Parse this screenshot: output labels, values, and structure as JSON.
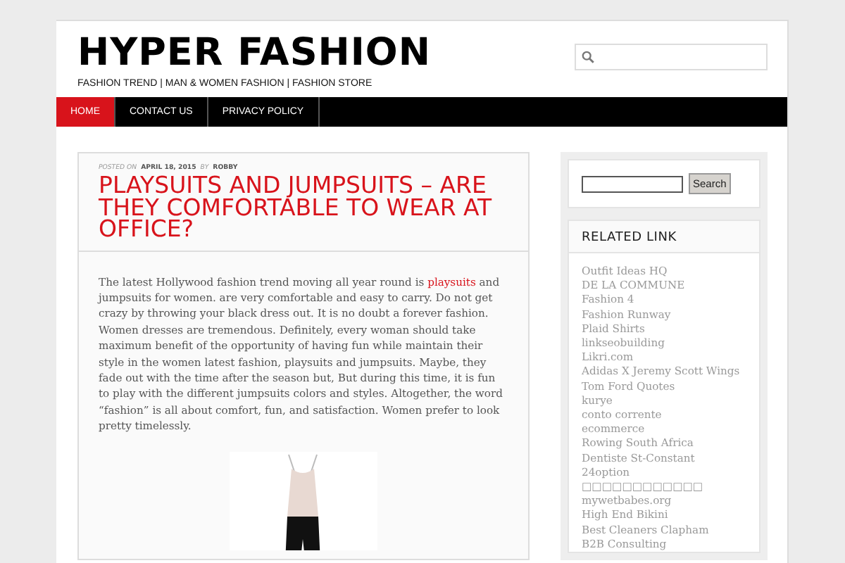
{
  "header": {
    "site_title": "HYPER FASHION",
    "tagline": "FASHION TREND | MAN & WOMEN FASHION | FASHION STORE"
  },
  "nav": [
    {
      "label": "HOME",
      "selected": true
    },
    {
      "label": "CONTACT US",
      "selected": false
    },
    {
      "label": "PRIVACY POLICY",
      "selected": false
    }
  ],
  "post": {
    "meta": [
      {
        "kind": "label",
        "text": "POSTED ON"
      },
      {
        "kind": "value",
        "text": "APRIL 18, 2015"
      },
      {
        "kind": "label",
        "text": "BY"
      },
      {
        "kind": "value",
        "text": "ROBBY"
      }
    ],
    "title": "PLAYSUITS AND JUMPSUITS – ARE THEY COMFORTABLE TO WEAR AT OFFICE?",
    "body_before_link": "The latest Hollywood fashion trend moving all year round is ",
    "body_link": "playsuits",
    "body_after_link": " and jumpsuits for women. are very comfortable and easy to carry. Do not get crazy by throwing your black dress out. It is no doubt a forever fashion. Women dresses are tremendous. Definitely, every woman should take maximum benefit of the opportunity of having fun while maintain their style in the women latest fashion, playsuits and jumpsuits. Maybe, they fade out with the time after the season but, But during this time, it is fun to play with the different jumpsuits colors and styles. Altogether, the word “fashion” is all about comfort, fun, and satisfaction. Women prefer to look pretty timelessly."
  },
  "sidebar": {
    "search_button": "Search",
    "related_title": "RELATED LINK",
    "related_links": [
      "Outfit Ideas HQ",
      "DE LA COMMUNE",
      "Fashion 4",
      "Fashion Runway",
      "Plaid Shirts",
      "linkseobuilding",
      "Likri.com",
      "Adidas X Jeremy Scott Wings",
      "Tom Ford Quotes",
      "kurye",
      "conto corrente",
      "ecommerce",
      "Rowing South Africa",
      "Dentiste St-Constant",
      "24option",
      "□□□□□□□□□□□□",
      "mywetbabes.org",
      "High End Bikini",
      "Best Cleaners Clapham",
      "B2B Consulting"
    ]
  }
}
